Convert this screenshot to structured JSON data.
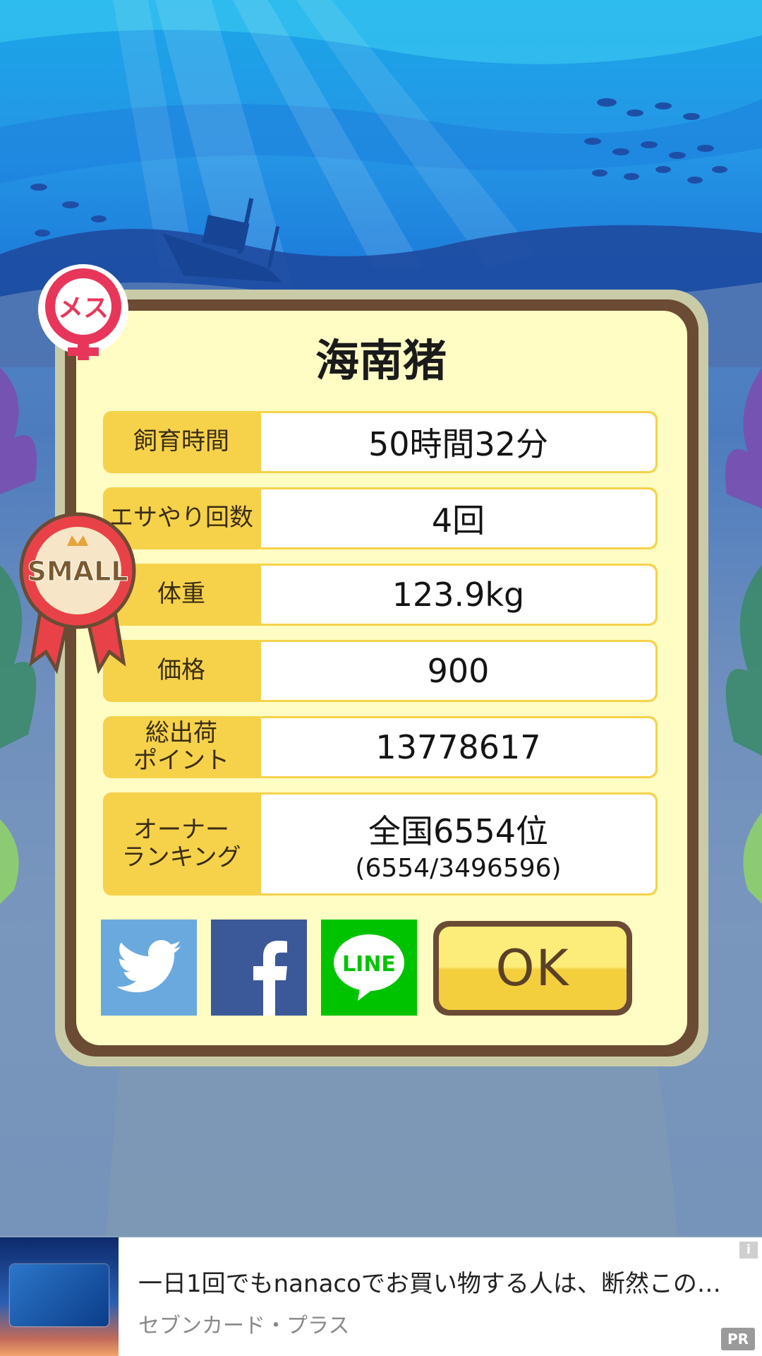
{
  "pig": {
    "name": "海南猪",
    "gender_badge": "メス",
    "size_ribbon": "SMALL"
  },
  "stats": [
    {
      "label": "飼育時間",
      "value": "50時間32分"
    },
    {
      "label": "エサやり回数",
      "value": "4回"
    },
    {
      "label": "体重",
      "value": "123.9kg"
    },
    {
      "label": "価格",
      "value": "900"
    },
    {
      "label": "総出荷\nポイント",
      "value": "13778617"
    },
    {
      "label": "オーナー\nランキング",
      "value": "全国6554位",
      "sub": "(6554/3496596)"
    }
  ],
  "share": {
    "twitter_icon": "twitter-icon",
    "facebook_icon": "facebook-icon",
    "line_icon": "line-icon",
    "line_text": "LINE"
  },
  "ok_button": "OK",
  "ad": {
    "headline": "一日1回でもnanacoでお買い物する人は、断然この…",
    "brand": "セブンカード・プラス",
    "badge_info": "i",
    "badge_pr": "PR"
  },
  "colors": {
    "panel": "#fffcc4",
    "panel_border": "#6b4b34",
    "label_bg": "#f6d24b",
    "gender_red": "#e8365a",
    "ribbon_red": "#e84248",
    "twitter": "#6aa9de",
    "facebook": "#3b5998",
    "line": "#00c300"
  }
}
